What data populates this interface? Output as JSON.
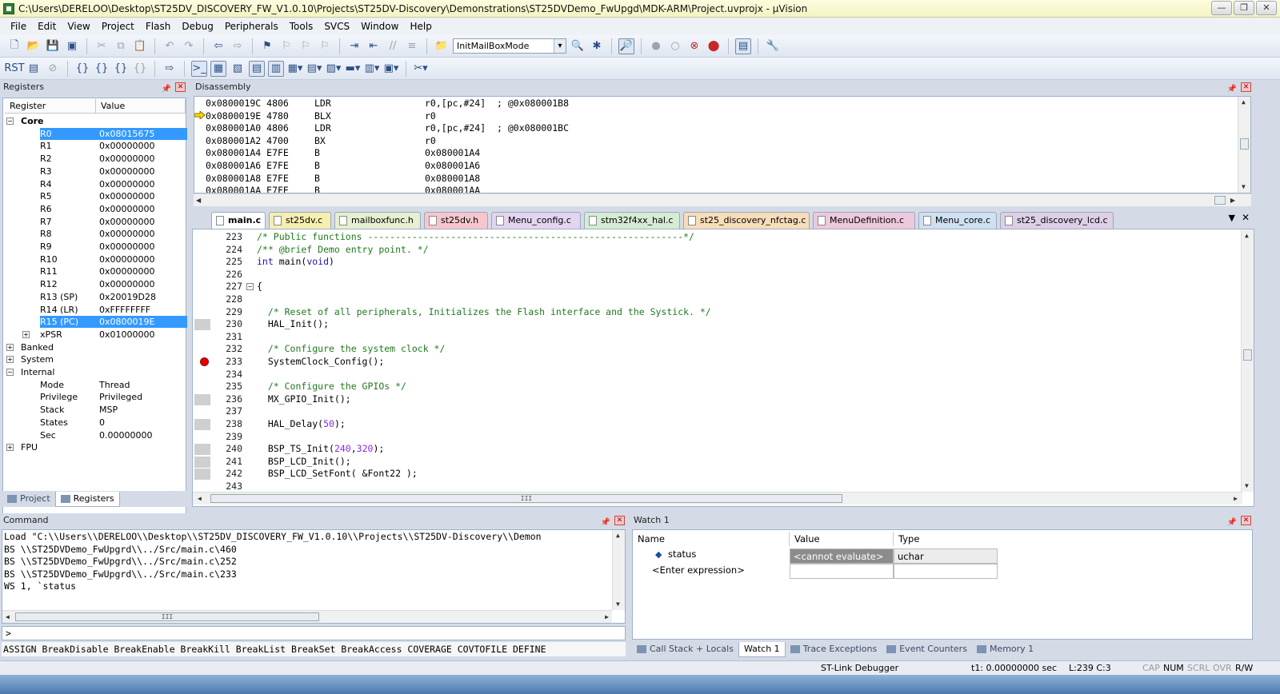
{
  "window": {
    "title": "C:\\Users\\DERELOO\\Desktop\\ST25DV_DISCOVERY_FW_V1.0.10\\Projects\\ST25DV-Discovery\\Demonstrations\\ST25DVDemo_FwUpgd\\MDK-ARM\\Project.uvprojx - µVision",
    "buttons": [
      "—",
      "❐",
      "✕"
    ]
  },
  "menu": [
    "File",
    "Edit",
    "View",
    "Project",
    "Flash",
    "Debug",
    "Peripherals",
    "Tools",
    "SVCS",
    "Window",
    "Help"
  ],
  "toolbar": {
    "combo_value": "InitMailBoxMode"
  },
  "registers": {
    "title": "Registers",
    "col_register": "Register",
    "col_value": "Value",
    "rows": [
      {
        "name": "Core",
        "value": ""
      },
      {
        "name": "R0",
        "value": "0x08015675"
      },
      {
        "name": "R1",
        "value": "0x00000000"
      },
      {
        "name": "R2",
        "value": "0x00000000"
      },
      {
        "name": "R3",
        "value": "0x00000000"
      },
      {
        "name": "R4",
        "value": "0x00000000"
      },
      {
        "name": "R5",
        "value": "0x00000000"
      },
      {
        "name": "R6",
        "value": "0x00000000"
      },
      {
        "name": "R7",
        "value": "0x00000000"
      },
      {
        "name": "R8",
        "value": "0x00000000"
      },
      {
        "name": "R9",
        "value": "0x00000000"
      },
      {
        "name": "R10",
        "value": "0x00000000"
      },
      {
        "name": "R11",
        "value": "0x00000000"
      },
      {
        "name": "R12",
        "value": "0x00000000"
      },
      {
        "name": "R13 (SP)",
        "value": "0x20019D28"
      },
      {
        "name": "R14 (LR)",
        "value": "0xFFFFFFFF"
      },
      {
        "name": "R15 (PC)",
        "value": "0x0800019E"
      },
      {
        "name": "xPSR",
        "value": "0x01000000"
      },
      {
        "name": "Banked",
        "value": ""
      },
      {
        "name": "System",
        "value": ""
      },
      {
        "name": "Internal",
        "value": ""
      },
      {
        "name": "Mode",
        "value": "Thread"
      },
      {
        "name": "Privilege",
        "value": "Privileged"
      },
      {
        "name": "Stack",
        "value": "MSP"
      },
      {
        "name": "States",
        "value": "0"
      },
      {
        "name": "Sec",
        "value": "0.00000000"
      },
      {
        "name": "FPU",
        "value": ""
      }
    ],
    "tabs": [
      "Project",
      "Registers"
    ]
  },
  "disassembly": {
    "title": "Disassembly",
    "lines": [
      {
        "addr": "0x0800019C 4806",
        "op": "LDR",
        "arg": "r0,[pc,#24]  ; @0x080001B8"
      },
      {
        "addr": "0x0800019E 4780",
        "op": "BLX",
        "arg": "r0"
      },
      {
        "addr": "0x080001A0 4806",
        "op": "LDR",
        "arg": "r0,[pc,#24]  ; @0x080001BC"
      },
      {
        "addr": "0x080001A2 4700",
        "op": "BX",
        "arg": "r0"
      },
      {
        "addr": "0x080001A4 E7FE",
        "op": "B",
        "arg": "0x080001A4"
      },
      {
        "addr": "0x080001A6 E7FE",
        "op": "B",
        "arg": "0x080001A6"
      },
      {
        "addr": "0x080001A8 E7FE",
        "op": "B",
        "arg": "0x080001A8"
      },
      {
        "addr": "0x080001AA E7FE",
        "op": "B",
        "arg": "0x080001AA"
      }
    ]
  },
  "editor": {
    "tabs": [
      {
        "label": "main.c",
        "color": "#ffffff"
      },
      {
        "label": "st25dv.c",
        "color": "#f5efb0"
      },
      {
        "label": "mailboxfunc.h",
        "color": "#e6efcf"
      },
      {
        "label": "st25dv.h",
        "color": "#f6c6cc"
      },
      {
        "label": "Menu_config.c",
        "color": "#e3d4f0"
      },
      {
        "label": "stm32f4xx_hal.c",
        "color": "#d6ebd3"
      },
      {
        "label": "st25_discovery_nfctag.c",
        "color": "#f7ddb9"
      },
      {
        "label": "MenuDefinition.c",
        "color": "#eec8dc"
      },
      {
        "label": "Menu_core.c",
        "color": "#cfe0f2"
      },
      {
        "label": "st25_discovery_lcd.c",
        "color": "#dccfe6"
      }
    ],
    "lines": [
      {
        "no": "223",
        "text": "/* Public functions ---------------------------------------------------------*/"
      },
      {
        "no": "224",
        "text": "/** @brief Demo entry point. */"
      },
      {
        "no": "225",
        "text": "int main(void)"
      },
      {
        "no": "226",
        "text": ""
      },
      {
        "no": "227",
        "text": "{"
      },
      {
        "no": "228",
        "text": ""
      },
      {
        "no": "229",
        "text": "  /* Reset of all peripherals, Initializes the Flash interface and the Systick. */"
      },
      {
        "no": "230",
        "text": "  HAL_Init();"
      },
      {
        "no": "231",
        "text": ""
      },
      {
        "no": "232",
        "text": "  /* Configure the system clock */"
      },
      {
        "no": "233",
        "text": "  SystemClock_Config();"
      },
      {
        "no": "234",
        "text": ""
      },
      {
        "no": "235",
        "text": "  /* Configure the GPIOs */"
      },
      {
        "no": "236",
        "text": "  MX_GPIO_Init();"
      },
      {
        "no": "237",
        "text": ""
      },
      {
        "no": "238",
        "text": "  HAL_Delay(50);"
      },
      {
        "no": "239",
        "text": ""
      },
      {
        "no": "240",
        "text": "  BSP_TS_Init(240,320);"
      },
      {
        "no": "241",
        "text": "  BSP_LCD_Init();"
      },
      {
        "no": "242",
        "text": "  BSP_LCD_SetFont( &Font22 );"
      },
      {
        "no": "243",
        "text": ""
      }
    ]
  },
  "command": {
    "title": "Command",
    "lines": [
      "Load \"C:\\\\Users\\\\DERELOO\\\\Desktop\\\\ST25DV_DISCOVERY_FW_V1.0.10\\\\Projects\\\\ST25DV-Discovery\\\\Demon",
      "BS \\\\ST25DVDemo_FwUpgrd\\\\../Src/main.c\\460",
      "BS \\\\ST25DVDemo_FwUpgrd\\\\../Src/main.c\\252",
      "BS \\\\ST25DVDemo_FwUpgrd\\\\../Src/main.c\\233",
      "WS 1, `status"
    ],
    "prompt": ">",
    "hints": "ASSIGN BreakDisable BreakEnable BreakKill BreakList BreakSet BreakAccess COVERAGE COVTOFILE DEFINE"
  },
  "watch": {
    "title": "Watch 1",
    "col_name": "Name",
    "col_value": "Value",
    "col_type": "Type",
    "rows": [
      {
        "name": "status",
        "value": "<cannot evaluate>",
        "type": "uchar"
      },
      {
        "name": "<Enter expression>",
        "value": "",
        "type": ""
      }
    ],
    "tabs": [
      "Call Stack + Locals",
      "Watch 1",
      "Trace Exceptions",
      "Event Counters",
      "Memory 1"
    ]
  },
  "statusbar": {
    "debugger": "ST-Link Debugger",
    "time": "t1: 0.00000000 sec",
    "position": "L:239 C:3",
    "cap": "CAP",
    "num": "NUM",
    "scrl": "SCRL",
    "ovr": "OVR",
    "rw": "R/W"
  }
}
